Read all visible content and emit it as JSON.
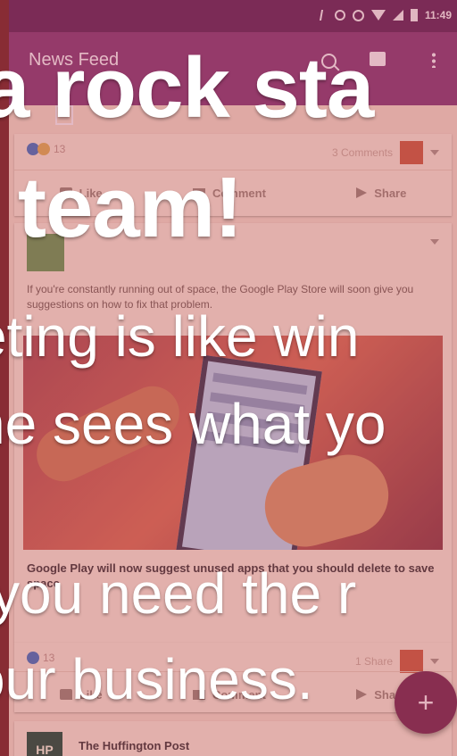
{
  "status_bar": {
    "time": "11:49"
  },
  "app_bar": {
    "title": "News Feed"
  },
  "card_top": {
    "reaction_count": "13",
    "comments": "3 Comments",
    "actions": {
      "like": "Like",
      "comment": "Comment",
      "share": "Share"
    }
  },
  "post": {
    "author": "",
    "text": "If you're constantly running out of space, the Google Play Store will soon give you suggestions on how to fix that problem.",
    "link_title": "Google Play will now suggest unused apps that you should delete to save space",
    "link_url": ""
  },
  "card_bottom": {
    "reaction_count": "13",
    "shares": "1 Share",
    "actions": {
      "like": "Like",
      "comment": "Comment",
      "share": "Share"
    }
  },
  "next_post": {
    "author": "The Huffington Post",
    "avatar_text": "HP"
  },
  "fab": {
    "label": "+"
  },
  "overlay": {
    "headline_1": "a rock sta",
    "headline_2": "team!",
    "line_1": "eting is like win",
    "line_2": "ne sees what yo",
    "line_3": "you need the r",
    "line_4": "our business."
  }
}
